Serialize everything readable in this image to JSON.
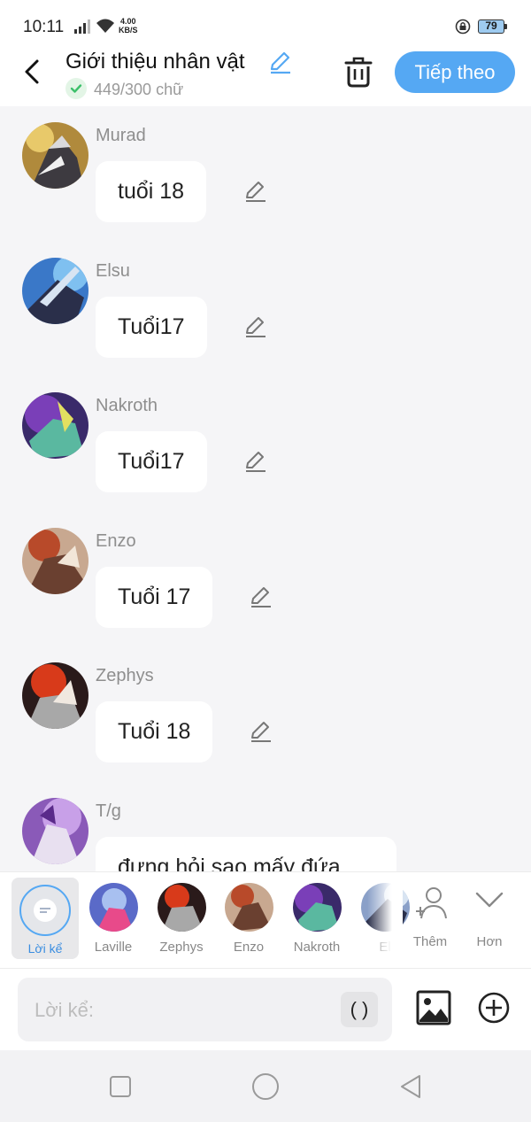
{
  "status_bar": {
    "time": "10:11",
    "speed_value": "4.00",
    "speed_unit": "KB/S",
    "battery": "79"
  },
  "header": {
    "title": "Giới thiệu nhân vật",
    "word_count": "449/300 chữ",
    "next_button": "Tiếp theo"
  },
  "messages": [
    {
      "name": "Murad",
      "text": "tuổi 18"
    },
    {
      "name": "Elsu",
      "text": "Tuổi17"
    },
    {
      "name": "Nakroth",
      "text": "Tuổi17"
    },
    {
      "name": "Enzo",
      "text": "Tuổi 17"
    },
    {
      "name": "Zephys",
      "text": "Tuổi 18"
    },
    {
      "name": "T/g",
      "text": "đựng hỏi sao mấy đứa"
    }
  ],
  "characters": {
    "narrator_label": "Lời kể",
    "items": [
      {
        "label": "Laville"
      },
      {
        "label": "Zephys"
      },
      {
        "label": "Enzo"
      },
      {
        "label": "Nakroth"
      },
      {
        "label": "El"
      }
    ],
    "add_label": "Thêm",
    "more_label": "Hơn"
  },
  "input": {
    "placeholder": "Lời kể:",
    "paren_button": "( )"
  },
  "colors": {
    "accent": "#55a8f3",
    "background": "#f5f5f7",
    "success": "#3cc06a"
  }
}
